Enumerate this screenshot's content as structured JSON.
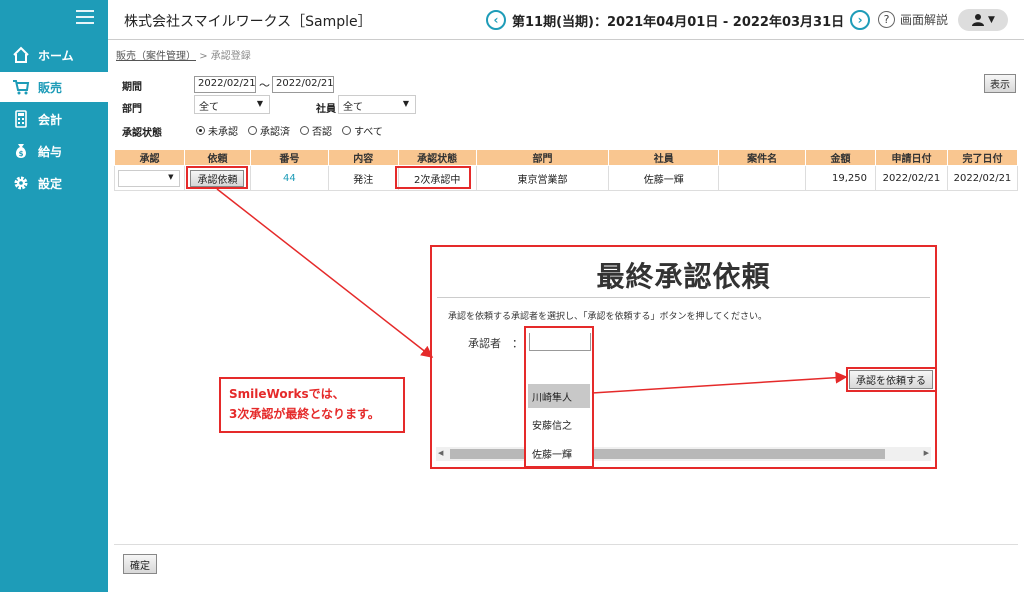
{
  "sidebar": {
    "items": [
      {
        "label": "ホーム",
        "icon": "home-icon"
      },
      {
        "label": "販売",
        "icon": "cart-icon"
      },
      {
        "label": "会計",
        "icon": "calculator-icon"
      },
      {
        "label": "給与",
        "icon": "money-bag-icon"
      },
      {
        "label": "設定",
        "icon": "gear-icon"
      }
    ],
    "active_index": 1,
    "colors": {
      "bg": "#1e9cb8"
    }
  },
  "header": {
    "company": "株式会社スマイルワークス［Sample］",
    "period": "第11期(当期)：2021年04月01日 - 2022年03月31日",
    "help": "画面解説",
    "user_caret": "▼"
  },
  "breadcrumb": {
    "link": "販売（案件管理）",
    "sep": ">",
    "current": "承認登録"
  },
  "filters": {
    "period_label": "期間",
    "date_from": "2022/02/21",
    "tilde": "～",
    "date_to": "2022/02/21",
    "dept_label": "部門",
    "dept_value": "全て",
    "emp_label": "社員",
    "emp_value": "全て",
    "status_label": "承認状態",
    "status_options": [
      "未承認",
      "承認済",
      "否認",
      "すべて"
    ],
    "status_selected": 0,
    "show_button": "表示"
  },
  "table": {
    "headers": [
      "承認",
      "依頼",
      "番号",
      "内容",
      "承認状態",
      "部門",
      "社員",
      "案件名",
      "金額",
      "申請日付",
      "完了日付"
    ],
    "row": {
      "request_button": "承認依頼",
      "number": "44",
      "content": "発注",
      "status": "2次承認中",
      "dept": "東京営業部",
      "employee": "佐藤一輝",
      "project": "",
      "amount": "19,250",
      "applied": "2022/02/21",
      "completed": "2022/02/21"
    }
  },
  "dialog": {
    "title": "最終承認依頼",
    "instruction": "承認を依頼する承認者を選択し、「承認を依頼する」ボタンを押してください。",
    "approver_label": "承認者　：",
    "submit_button": "承認を依頼する",
    "options": [
      "川崎隼人",
      "安藤信之",
      "佐藤一輝"
    ],
    "highlighted": 0
  },
  "callout": {
    "line1": "SmileWorksでは、",
    "line2": "3次承認が最終となります。"
  },
  "footer": {
    "confirm_button": "確定"
  },
  "colors": {
    "accent": "#1e9cb8",
    "header_row": "#f9c690",
    "annotation": "#e52a2a",
    "link": "#1e9cb8"
  }
}
